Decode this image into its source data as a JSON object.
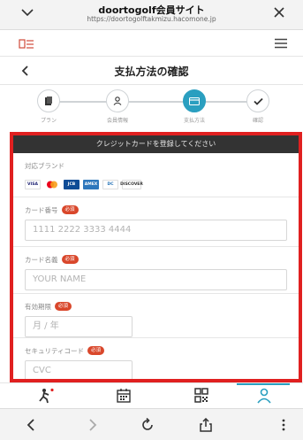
{
  "browser": {
    "title": "doortogolf会員サイト",
    "url": "https://doortogolftakmizu.hacomone.jp"
  },
  "header": {
    "logo_icon": "brand-logo",
    "menu_icon": "hamburger-icon"
  },
  "nav": {
    "title": "支払方法の確認",
    "back_icon": "chevron-left-icon"
  },
  "steps": [
    {
      "label": "プラン",
      "icon": "document-icon",
      "state": "done"
    },
    {
      "label": "会員情報",
      "icon": "person-icon",
      "state": "done"
    },
    {
      "label": "支払方法",
      "icon": "card-icon",
      "state": "active"
    },
    {
      "label": "確認",
      "icon": "check-icon",
      "state": "pending"
    }
  ],
  "card_form": {
    "heading": "クレジットカードを登録してください",
    "brands_label": "対応ブランド",
    "brands": [
      "VISA",
      "MC",
      "JCB",
      "AMEX",
      "DC",
      "DISCOVER"
    ],
    "required_badge": "必須",
    "card_number": {
      "label": "カード番号",
      "placeholder": "1111 2222 3333 4444"
    },
    "card_name": {
      "label": "カード名義",
      "placeholder": "YOUR NAME"
    },
    "expiry": {
      "label": "有効期限",
      "placeholder": "月 / 年"
    },
    "cvc": {
      "label": "セキュリティコード",
      "placeholder": "CVC"
    }
  },
  "colors": {
    "accent": "#2a9fc0",
    "required": "#d9472b",
    "highlight_border": "#e02020",
    "panel_header": "#333333"
  },
  "bottom_tabs": [
    {
      "icon": "golfer-icon",
      "active": false
    },
    {
      "icon": "calendar-icon",
      "active": false
    },
    {
      "icon": "qr-code-icon",
      "active": false
    },
    {
      "icon": "person-icon",
      "active": true
    }
  ],
  "browser_nav": [
    "back-icon",
    "forward-icon",
    "reload-icon",
    "share-icon",
    "more-icon"
  ]
}
